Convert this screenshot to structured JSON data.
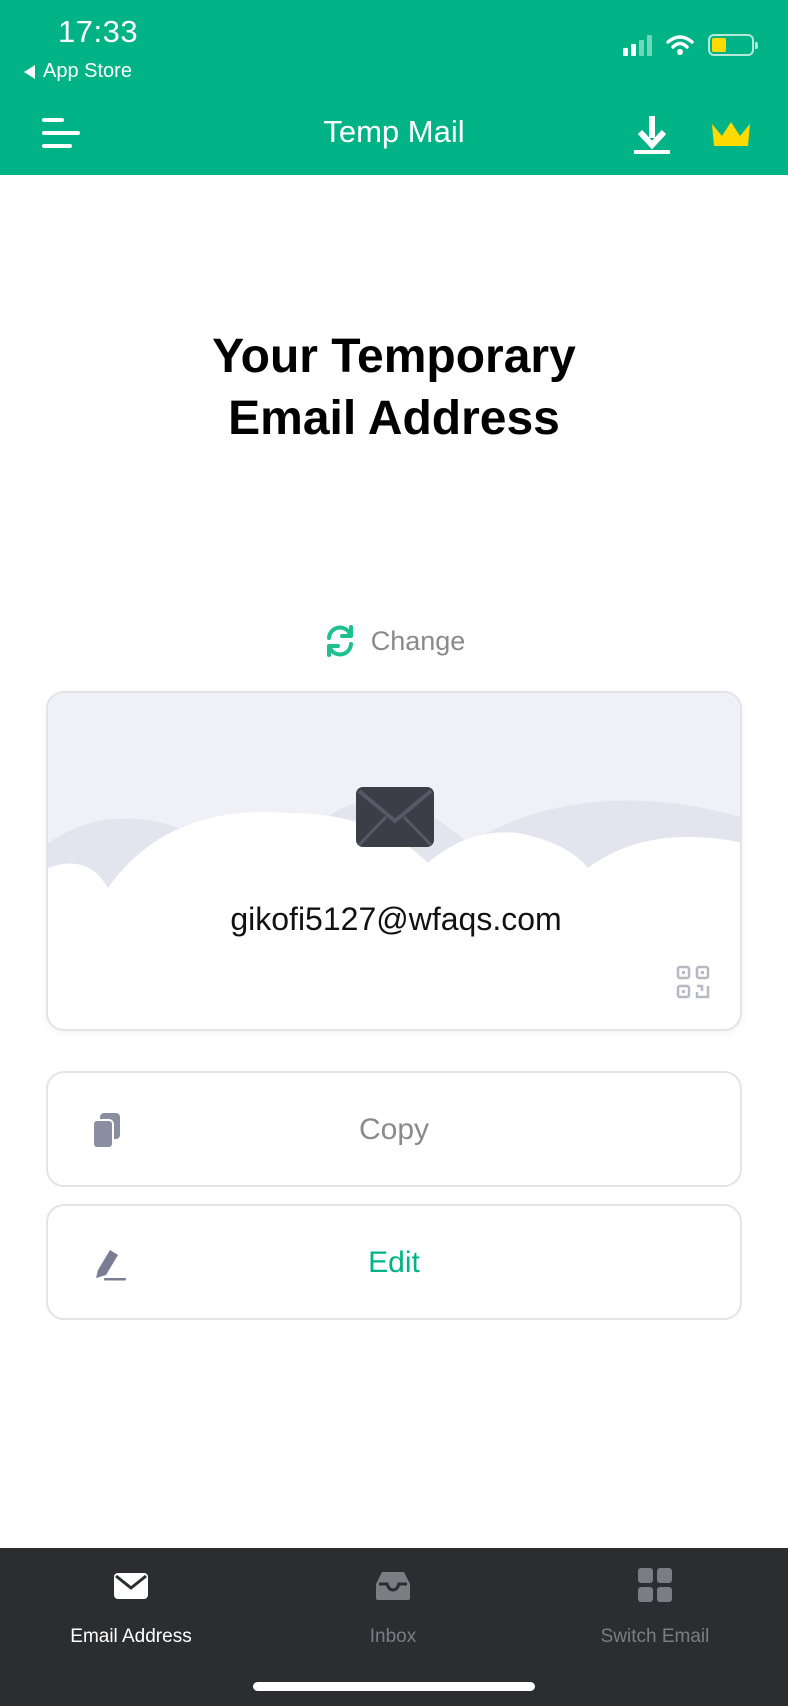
{
  "status_bar": {
    "time": "17:33",
    "back_app": "App Store"
  },
  "header": {
    "title": "Temp Mail"
  },
  "main": {
    "headline_line1": "Your Temporary",
    "headline_line2": "Email Address",
    "change_label": "Change",
    "email": "gikofi5127@wfaqs.com",
    "copy_label": "Copy",
    "edit_label": "Edit"
  },
  "tabs": [
    {
      "label": "Email Address",
      "icon": "envelope-icon",
      "active": true
    },
    {
      "label": "Inbox",
      "icon": "inbox-icon",
      "active": false
    },
    {
      "label": "Switch Email",
      "icon": "grid-icon",
      "active": false
    }
  ],
  "colors": {
    "brand": "#00b386",
    "tabbar": "#2c2d31",
    "muted": "#8a8a8e"
  }
}
